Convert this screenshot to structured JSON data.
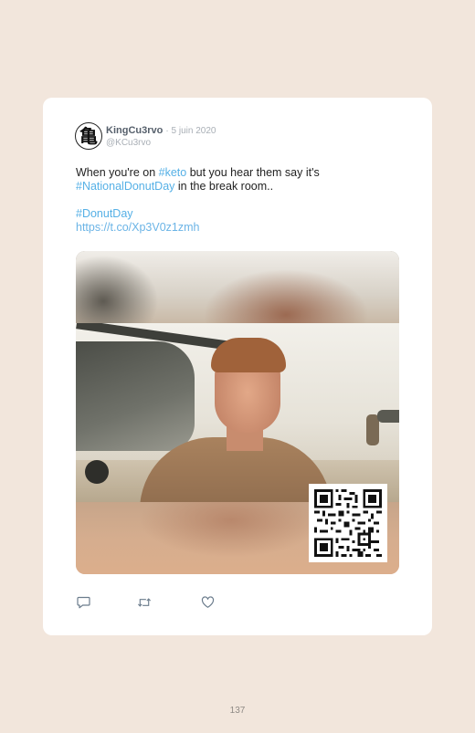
{
  "tweet": {
    "author_name": "KingCu3rvo",
    "date": "5 juin 2020",
    "handle": "@KCu3rvo",
    "avatar_glyph": "亀",
    "text": {
      "line1_before": "When you're on ",
      "line1_hashtag": "#keto",
      "line1_after": " but you hear them say it's",
      "line2_hashtag": "#NationalDonutDay",
      "line2_after": " in the break room..",
      "hashtag_donut": "#DonutDay",
      "link": "https://t.co/Xp3V0z1zmh"
    },
    "media": {
      "type": "video-still-with-qr-code"
    },
    "actions": [
      {
        "name": "reply",
        "icon": "speech-bubble-icon"
      },
      {
        "name": "retweet",
        "icon": "retweet-arrows-icon"
      },
      {
        "name": "like",
        "icon": "heart-icon"
      }
    ]
  },
  "page": {
    "number": "137"
  },
  "colors": {
    "background": "#f2e6dc",
    "card": "#ffffff",
    "hashtag": "#55b0e6",
    "name": "#555f6b",
    "muted": "#a9afb6"
  }
}
